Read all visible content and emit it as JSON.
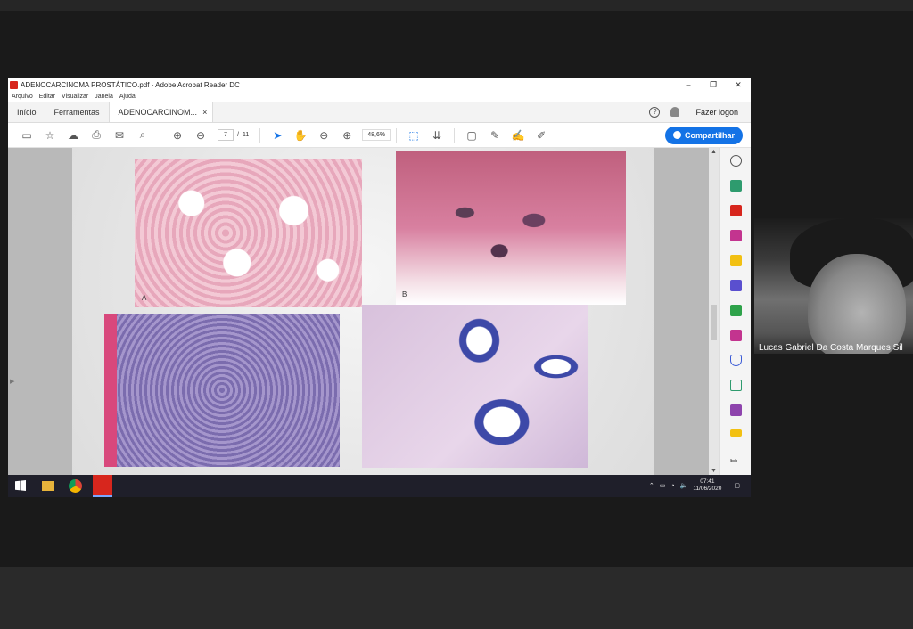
{
  "window": {
    "title": "ADENOCARCINOMA PROSTÁTICO.pdf - Adobe Acrobat Reader DC",
    "controls": [
      "–",
      "❐",
      "✕"
    ]
  },
  "menu": [
    "Arquivo",
    "Editar",
    "Visualizar",
    "Janela",
    "Ajuda"
  ],
  "tabs": {
    "home": "Início",
    "tools": "Ferramentas",
    "document": "ADENOCARCINOM...",
    "close": "×"
  },
  "account": {
    "help": "?",
    "login": "Fazer logon"
  },
  "toolbar": {
    "page_current": "7",
    "page_separator": "/",
    "page_total": "11",
    "zoom": "48,6%",
    "share_label": "Compartilhar"
  },
  "document": {
    "image_labels": [
      "A",
      "B"
    ]
  },
  "taskbar": {
    "time": "07:41",
    "date": "11/06/2020"
  },
  "webcam": {
    "participant_name": "Lucas Gabriel Da Costa Marques Sil"
  },
  "colors": {
    "accent": "#1473e6",
    "acrobat_red": "#d7261d",
    "taskbar": "#1f1f2a"
  }
}
